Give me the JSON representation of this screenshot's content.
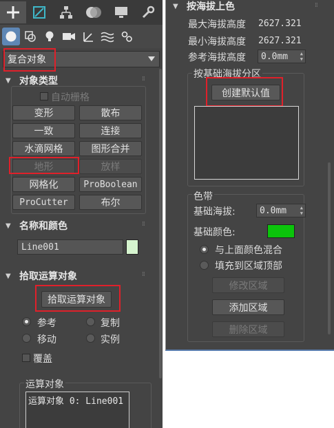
{
  "left_panel": {
    "command_tabs": [
      {
        "icon": "plus-icon",
        "label": "+"
      },
      {
        "icon": "modify-icon"
      },
      {
        "icon": "hierarchy-icon"
      },
      {
        "icon": "motion-icon"
      },
      {
        "icon": "display-icon"
      },
      {
        "icon": "utilities-wrench-icon"
      }
    ],
    "category_icons": [
      "geometry-sphere-icon",
      "shapes-icon",
      "lights-icon",
      "cameras-icon",
      "helpers-icon",
      "spacewarps-icon",
      "systems-icon"
    ],
    "dropdown_value": "复合对象",
    "object_type": {
      "title": "对象类型",
      "autogrid_label": "自动栅格",
      "buttons": [
        {
          "label": "变形",
          "enabled": true
        },
        {
          "label": "散布",
          "enabled": true
        },
        {
          "label": "一致",
          "enabled": true
        },
        {
          "label": "连接",
          "enabled": true
        },
        {
          "label": "水滴网格",
          "enabled": true
        },
        {
          "label": "图形合并",
          "enabled": true
        },
        {
          "label": "地形",
          "enabled": false
        },
        {
          "label": "放样",
          "enabled": false
        },
        {
          "label": "网格化",
          "enabled": true
        },
        {
          "label": "ProBoolean",
          "enabled": true
        },
        {
          "label": "ProCutter",
          "enabled": true
        },
        {
          "label": "布尔",
          "enabled": true
        }
      ]
    },
    "name_color": {
      "title": "名称和颜色",
      "name_value": "Line001",
      "swatch_color": "#d6f5cf"
    },
    "pick_operand": {
      "title": "拾取运算对象",
      "button_label": "拾取运算对象",
      "radios": [
        {
          "label": "参考",
          "checked": true
        },
        {
          "label": "复制",
          "checked": false
        },
        {
          "label": "移动",
          "checked": false
        },
        {
          "label": "实例",
          "checked": false
        }
      ],
      "overlay_label": "覆盖"
    },
    "operands": {
      "title": "运算对象",
      "items": [
        "运算对象 0: Line001"
      ]
    }
  },
  "right_panel": {
    "color_by_elevation_title": "按海拔上色",
    "max_elevation_label": "最大海拔高度",
    "max_elevation_value": "2627.321",
    "min_elevation_label": "最小海拔高度",
    "min_elevation_value": "2627.321",
    "ref_elevation_label": "参考海拔高度",
    "ref_elevation_value": "0.0mm",
    "zones_group_title": "按基础海拔分区",
    "create_defaults_label": "创建默认值",
    "color_zone_title": "色带",
    "base_elevation_label": "基础海拔:",
    "base_elevation_value": "0.0mm",
    "base_color_label": "基础颜色:",
    "base_color": "#0bc40b",
    "blend_label": "与上面颜色混合",
    "fill_label": "填充到区域顶部",
    "modify_zone_label": "修改区域",
    "add_zone_label": "添加区域",
    "delete_zone_label": "删除区域"
  },
  "colors": {
    "highlight_red": "#e0202a",
    "active_blue": "#5e87b5"
  }
}
